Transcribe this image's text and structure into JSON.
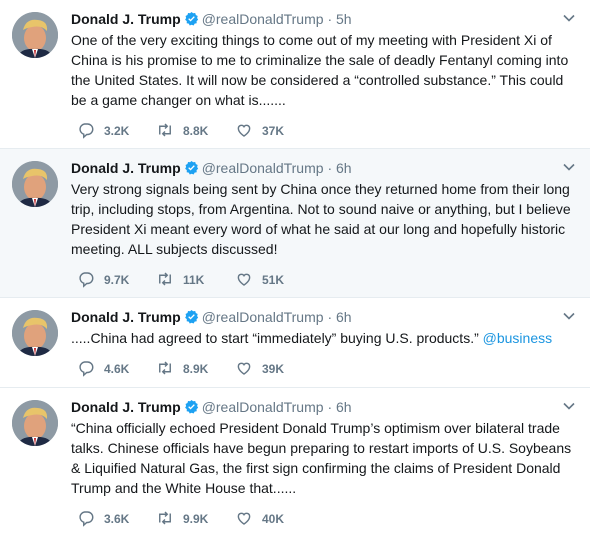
{
  "tweets": [
    {
      "name": "Donald J. Trump",
      "handle": "@realDonaldTrump",
      "dot": "·",
      "time": "5h",
      "text": "One of the very exciting things to come out of my meeting with President Xi of China is his promise to me to criminalize the sale of deadly Fentanyl coming into the United States. It will now be considered a “controlled substance.” This could be a game changer on what is.......",
      "link": "",
      "replies": "3.2K",
      "retweets": "8.8K",
      "likes": "37K"
    },
    {
      "name": "Donald J. Trump",
      "handle": "@realDonaldTrump",
      "dot": "·",
      "time": "6h",
      "text": "Very strong signals being sent by China once they returned home from their long trip, including stops, from Argentina. Not to sound naive or anything, but I believe President Xi meant every word of what he said at our long and hopefully historic meeting. ALL subjects discussed!",
      "link": "",
      "replies": "9.7K",
      "retweets": "11K",
      "likes": "51K"
    },
    {
      "name": "Donald J. Trump",
      "handle": "@realDonaldTrump",
      "dot": "·",
      "time": "6h",
      "text": ".....China had agreed to start “immediately” buying U.S. products.”",
      "link": "@business",
      "replies": "4.6K",
      "retweets": "8.9K",
      "likes": "39K"
    },
    {
      "name": "Donald J. Trump",
      "handle": "@realDonaldTrump",
      "dot": "·",
      "time": "6h",
      "text": "“China officially echoed President Donald Trump’s optimism over bilateral trade talks. Chinese officials have begun preparing to restart imports of U.S. Soybeans & Liquified Natural Gas, the first sign confirming the claims of President Donald Trump and the White House that......",
      "link": "",
      "replies": "3.6K",
      "retweets": "9.9K",
      "likes": "40K"
    }
  ],
  "icons": {
    "verified": "verified-badge-icon",
    "caret": "chevron-down-icon",
    "reply": "reply-icon",
    "retweet": "retweet-icon",
    "like": "heart-icon"
  },
  "colors": {
    "accent": "#1da1f2",
    "link": "#1b95e0",
    "muted": "#657786",
    "text": "#14171a",
    "divider": "#e6ecf0",
    "highlight_bg": "#f5f8fa"
  }
}
